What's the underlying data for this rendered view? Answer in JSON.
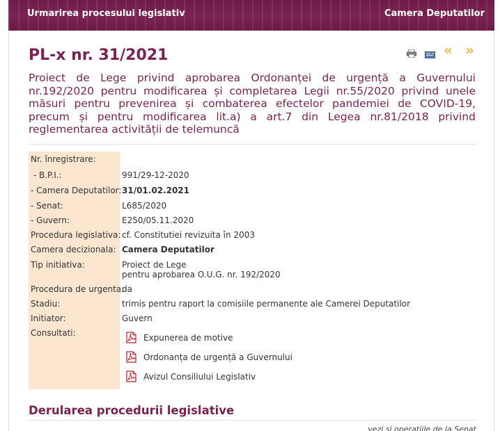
{
  "header": {
    "left_title": "Urmarirea procesului legislativ",
    "right_title": "Camera Deputatilor"
  },
  "page": {
    "title": "PL-x nr. 31/2021",
    "subtitle": "Proiect de Lege privind aprobarea Ordonanței de urgență a Guvernului nr.192/2020 pentru modificarea și completarea Legii nr.55/2020 privind unele măsuri pentru prevenirea și combaterea efectelor pandemiei de COVID-19, precum și pentru modificarea lit.a) a art.7 din Legea nr.81/2018 privind reglementarea activității de telemuncă"
  },
  "toolbar": {
    "icons": [
      "print-icon",
      "mail-icon",
      "prev-icon",
      "next-icon"
    ],
    "prev_glyph": "«",
    "next_glyph": "»",
    "accent_color": "#e8b84a"
  },
  "details": {
    "nr_inregistrare": {
      "label": "Nr. înregistrare:"
    },
    "bpi": {
      "label": " - B.P.I.:",
      "value": "991/29-12-2020"
    },
    "camera_deputatilor": {
      "label": "- Camera Deputatilor:",
      "value": "31/01.02.2021"
    },
    "senat": {
      "label": "- Senat:",
      "value": "L685/2020"
    },
    "guvern": {
      "label": "- Guvern:",
      "value": "E250/05.11.2020"
    },
    "procedura_legislativa": {
      "label": "Procedura legislativa:",
      "value": "cf. Constitutiei revizuita în 2003"
    },
    "camera_decizionala": {
      "label": "Camera decizionala:",
      "value": "Camera Deputatilor"
    },
    "tip_initiativa": {
      "label": "Tip initiativa:",
      "value_line1": "Proiect de Lege",
      "value_line2": "pentru aprobarea O.U.G. nr. 192/2020"
    },
    "procedura_urgenta": {
      "label": "Procedura de urgenta:",
      "value": "da"
    },
    "stadiu": {
      "label": "Stadiu:",
      "value": "trimis pentru raport la comisiile permanente ale Camerei Deputatilor"
    },
    "initiator": {
      "label": "Initiator:",
      "value": "Guvern"
    },
    "consultati": {
      "label": "Consultati:",
      "documents": [
        {
          "label": "Expunerea de motive",
          "icon": "pdf-icon"
        },
        {
          "label": "Ordonanța de urgență a Guvernului",
          "icon": "pdf-icon"
        },
        {
          "label": "Avizul Consiliului Legislativ",
          "icon": "pdf-icon"
        }
      ]
    }
  },
  "section": {
    "title": "Derularea procedurii legislative",
    "note": "vezi și operațiile de la Senat"
  },
  "colors": {
    "brand": "#7a2352",
    "label_background": "#fbe6cf"
  }
}
